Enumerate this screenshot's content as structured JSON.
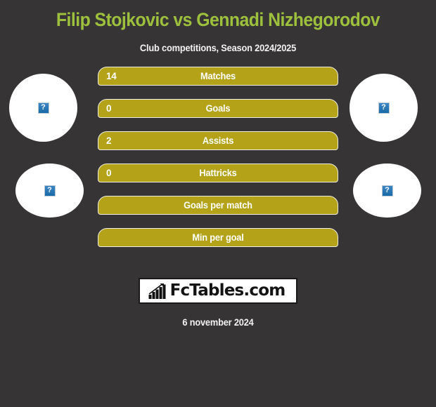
{
  "header": {
    "title": "Filip Stojkovic vs Gennadi Nizhegorodov",
    "subtitle": "Club competitions, Season 2024/2025",
    "title_color": "#9dc13c"
  },
  "players": {
    "home": {
      "photo_alt": "?"
    },
    "away": {
      "photo_alt": "?"
    },
    "home_secondary": {
      "photo_alt": "?"
    },
    "away_secondary": {
      "photo_alt": "?"
    }
  },
  "chart_data": {
    "type": "bar",
    "title": "Filip Stojkovic vs Gennadi Nizhegorodov",
    "subtitle": "Club competitions, Season 2024/2025",
    "categories": [
      "Matches",
      "Goals",
      "Assists",
      "Hattricks",
      "Goals per match",
      "Min per goal"
    ],
    "values": [
      14,
      0,
      2,
      0,
      null,
      null
    ],
    "value_labels": [
      "14",
      "0",
      "2",
      "0",
      "",
      ""
    ],
    "bar_color": "#b4a218",
    "bar_outline_color": "#efeee2",
    "background": "#373435",
    "grid": false,
    "legend": false,
    "xlabel": "",
    "ylabel": ""
  },
  "stats": [
    {
      "label": "Matches",
      "value": "14"
    },
    {
      "label": "Goals",
      "value": "0"
    },
    {
      "label": "Assists",
      "value": "2"
    },
    {
      "label": "Hattricks",
      "value": "0"
    },
    {
      "label": "Goals per match",
      "value": ""
    },
    {
      "label": "Min per goal",
      "value": ""
    }
  ],
  "footer": {
    "logo_text": "FcTables.com",
    "logo_icon": "bar-chart-growth-icon",
    "date": "6 november 2024"
  }
}
